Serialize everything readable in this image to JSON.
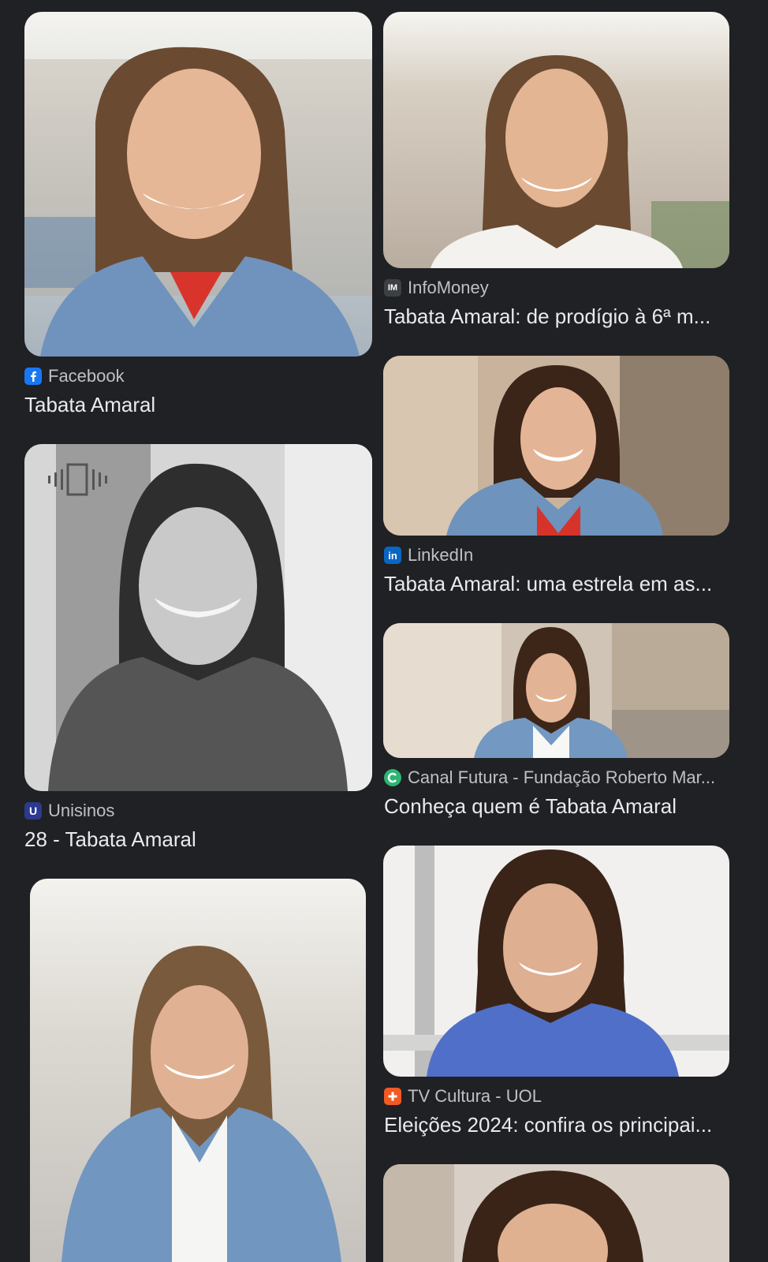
{
  "results": [
    {
      "source": "Facebook",
      "title": "Tabata Amaral",
      "favicon": "facebook-icon",
      "fav_color": "#1877f2"
    },
    {
      "source": "InfoMoney",
      "title": "Tabata Amaral: de prodígio à 6ª m...",
      "favicon": "infomoney-icon",
      "fav_color": "#3c4043",
      "fav_text": "IM"
    },
    {
      "source": "LinkedIn",
      "title": "Tabata Amaral: uma estrela em as...",
      "favicon": "linkedin-icon",
      "fav_color": "#0a66c2",
      "fav_text": "in"
    },
    {
      "source": "Unisinos",
      "title": "28 - Tabata Amaral",
      "favicon": "unisinos-icon",
      "fav_color": "#2b3a8f",
      "fav_text": "U"
    },
    {
      "source": "Canal Futura - Fundação Roberto Mar...",
      "title": "Conheça quem é Tabata Amaral",
      "favicon": "canal-futura-icon",
      "fav_color": "#2bb673"
    },
    {
      "source": "TV Cultura - UOL",
      "title": "Eleições 2024: confira os principai...",
      "favicon": "tv-cultura-icon",
      "fav_color": "#f15a24"
    }
  ],
  "colors": {
    "background": "#202124",
    "title": "#e8eaed",
    "source": "#bdc1c6"
  }
}
